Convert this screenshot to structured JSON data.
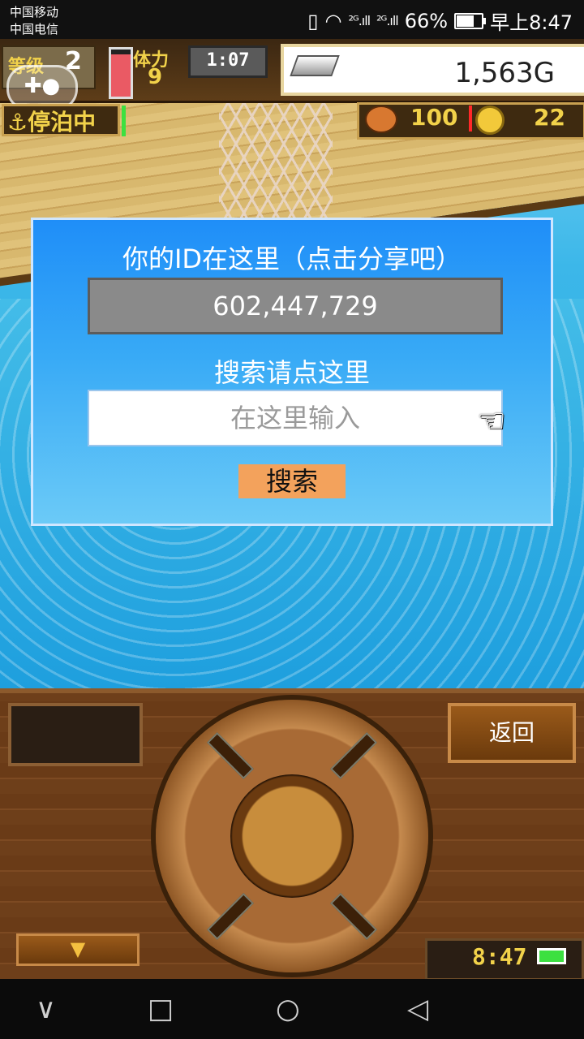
{
  "status_bar": {
    "carrier_1": "中国移动",
    "carrier_2": "中国电信",
    "signal_1": "²ᴳ.ıll",
    "signal_2": "²ᴳ.ıll",
    "battery": "66%",
    "time": "早上8:47"
  },
  "hud": {
    "level_label": "等级",
    "level_value": "2",
    "stamina_label": "体力",
    "stamina_value": "9",
    "stamina_fill_fraction": 0.9,
    "timer": "1:07",
    "gold": "1,563G",
    "status_badge": "⚓停泊中",
    "food_value": "100",
    "coin_value": "22"
  },
  "dialog": {
    "title": "你的ID在这里（点击分享吧）",
    "player_id": "602,447,729",
    "search_label": "搜索请点这里",
    "search_placeholder": "在这里输入",
    "search_value": "",
    "search_button": "搜索"
  },
  "console": {
    "return_button": "返回",
    "arrow_button": "▼",
    "clock": "8:47"
  },
  "nav": {
    "back": "∨",
    "recents": "□",
    "home": "○",
    "triangle": "◁"
  },
  "colors": {
    "dialog_blue": "#1f8ef8",
    "search_button": "#f3a25c",
    "hud_yellow": "#f2d24a"
  }
}
